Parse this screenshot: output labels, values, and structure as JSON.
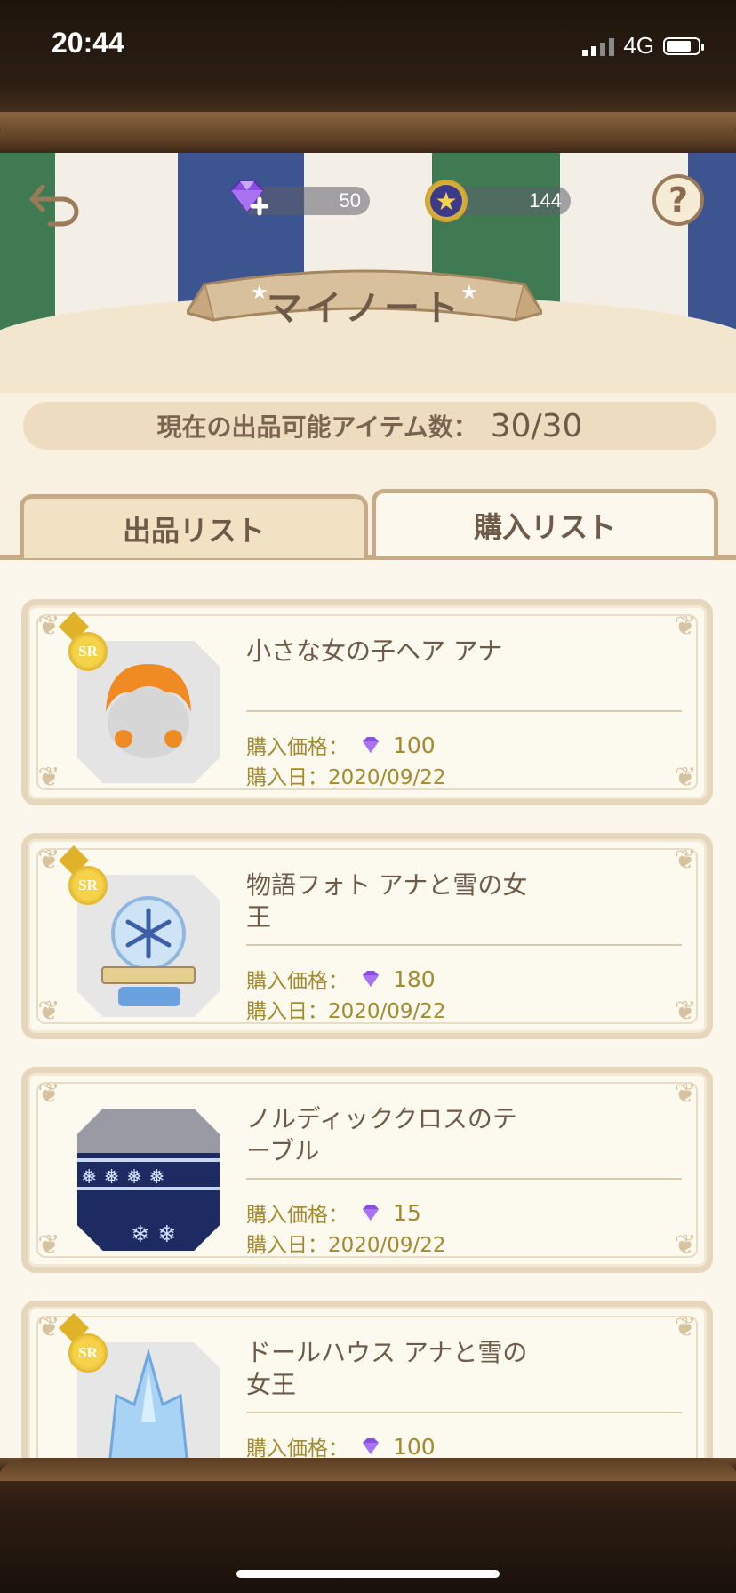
{
  "status": {
    "time": "20:44",
    "network": "4G"
  },
  "header": {
    "gems": "50",
    "coins": "144",
    "title": "マイノート"
  },
  "counter": {
    "label": "現在の出品可能アイテム数：",
    "value": "30/30"
  },
  "tabs": {
    "listing": "出品リスト",
    "purchase": "購入リスト"
  },
  "items": [
    {
      "rarity": "SR",
      "name": "小さな女の子ヘア アナ",
      "price_label": "購入価格：",
      "price": "100",
      "date_label": "購入日：",
      "date": "2020/09/22",
      "thumb_icon": "orange-hair-icon"
    },
    {
      "rarity": "SR",
      "name": "物語フォト アナと雪の女王",
      "price_label": "購入価格：",
      "price": "180",
      "date_label": "購入日：",
      "date": "2020/09/22",
      "thumb_icon": "snowflake-photo-icon"
    },
    {
      "rarity": "",
      "name": "ノルディッククロスのテーブル",
      "price_label": "購入価格：",
      "price": "15",
      "date_label": "購入日：",
      "date": "2020/09/22",
      "thumb_icon": "nordic-table-cloth-icon"
    },
    {
      "rarity": "SR",
      "name": "ドールハウス アナと雪の女王",
      "price_label": "購入価格：",
      "price": "100",
      "date_label": "購入日：",
      "date": "",
      "thumb_icon": "ice-castle-icon"
    }
  ],
  "colors": {
    "gem": "#8b4fe0",
    "coin_gold": "#d9b13a",
    "price_text": "#a38a2e",
    "text": "#6e5a48"
  }
}
